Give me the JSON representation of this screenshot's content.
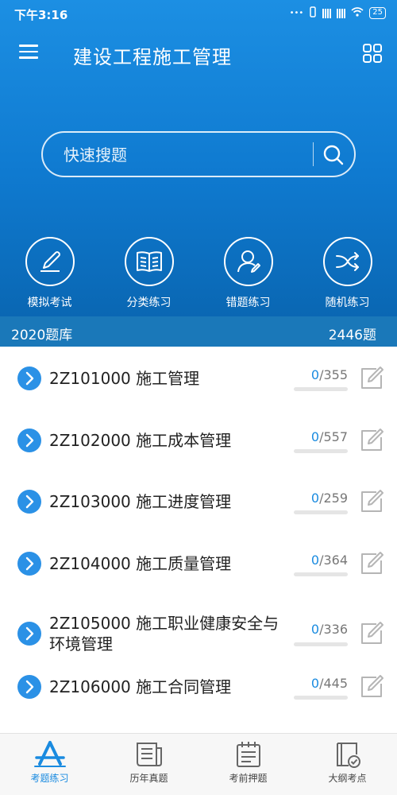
{
  "status": {
    "time": "下午3:16",
    "battery": "25"
  },
  "header": {
    "title": "建设工程施工管理"
  },
  "search": {
    "placeholder": "快速搜题"
  },
  "quick_actions": [
    {
      "label": "模拟考试",
      "icon": "pencil-icon"
    },
    {
      "label": "分类练习",
      "icon": "book-icon"
    },
    {
      "label": "错题练习",
      "icon": "user-edit-icon"
    },
    {
      "label": "随机练习",
      "icon": "shuffle-icon"
    }
  ],
  "question_bank": {
    "name": "2020题库",
    "count": "2446题"
  },
  "chapters": [
    {
      "title": "2Z101000 施工管理",
      "done": "0",
      "total": "/355",
      "progress": 0
    },
    {
      "title": "2Z102000 施工成本管理",
      "done": "0",
      "total": "/557",
      "progress": 0
    },
    {
      "title": "2Z103000 施工进度管理",
      "done": "0",
      "total": "/259",
      "progress": 0
    },
    {
      "title": "2Z104000 施工质量管理",
      "done": "0",
      "total": "/364",
      "progress": 0
    },
    {
      "title": "2Z105000 施工职业健康安全与环境管理",
      "done": "0",
      "total": "/336",
      "progress": 0
    },
    {
      "title": "2Z106000 施工合同管理",
      "done": "0",
      "total": "/445",
      "progress": 0
    }
  ],
  "tabs": [
    {
      "label": "考题练习",
      "icon": "app-store-icon",
      "active": true
    },
    {
      "label": "历年真题",
      "icon": "newspaper-icon",
      "active": false
    },
    {
      "label": "考前押题",
      "icon": "notepad-icon",
      "active": false
    },
    {
      "label": "大纲考点",
      "icon": "outline-check-icon",
      "active": false
    }
  ],
  "colors": {
    "primary": "#1a8be0",
    "bank_bar": "#1a78b9"
  }
}
